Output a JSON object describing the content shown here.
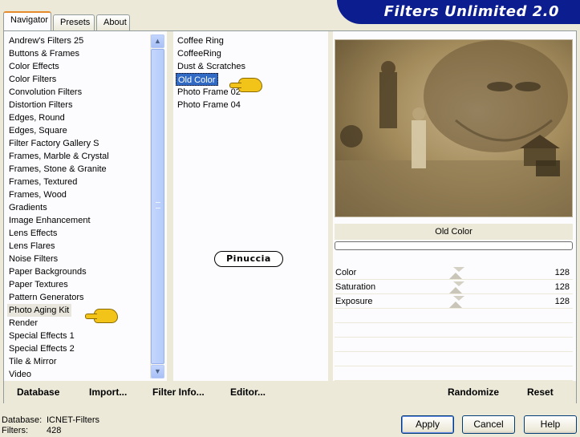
{
  "window": {
    "title": "Filters Unlimited 2.0"
  },
  "tabs": [
    {
      "label": "Navigator",
      "active": true
    },
    {
      "label": "Presets",
      "active": false
    },
    {
      "label": "About",
      "active": false
    }
  ],
  "categories": [
    "Andrew's Filters 25",
    "Buttons & Frames",
    "Color Effects",
    "Color Filters",
    "Convolution Filters",
    "Distortion Filters",
    "Edges, Round",
    "Edges, Square",
    "Filter Factory Gallery S",
    "Frames, Marble & Crystal",
    "Frames, Stone & Granite",
    "Frames, Textured",
    "Frames, Wood",
    "Gradients",
    "Image Enhancement",
    "Lens Effects",
    "Lens Flares",
    "Noise Filters",
    "Paper Backgrounds",
    "Paper Textures",
    "Pattern Generators",
    "Photo Aging Kit",
    "Render",
    "Special Effects 1",
    "Special Effects 2",
    "Tile & Mirror",
    "Video"
  ],
  "selected_category": "Photo Aging Kit",
  "filters": [
    "Coffee Ring",
    "CoffeeRing",
    "Dust & Scratches",
    "Old Color",
    "Photo Frame 02",
    "Photo Frame 04"
  ],
  "selected_filter": "Old Color",
  "watermark": "Pinuccia",
  "effect_name": "Old Color",
  "sliders": [
    {
      "label": "Color",
      "value": "128"
    },
    {
      "label": "Saturation",
      "value": "128"
    },
    {
      "label": "Exposure",
      "value": "128"
    }
  ],
  "bottom_buttons": {
    "database": "Database",
    "import": "Import...",
    "filter_info": "Filter Info...",
    "editor": "Editor...",
    "randomize": "Randomize",
    "reset": "Reset"
  },
  "status": {
    "database_label": "Database:",
    "database_value": "ICNET-Filters",
    "filters_label": "Filters:",
    "filters_value": "428"
  },
  "dialog_buttons": {
    "apply": "Apply",
    "cancel": "Cancel",
    "help": "Help"
  },
  "colors": {
    "title_banner": "#0c1d8f",
    "selection": "#316ac5",
    "dialog_bg": "#ece9d8",
    "tab_accent": "#e68b2c",
    "pointer": "#f2c318"
  },
  "icons": [
    "scroll-up-arrow-icon",
    "scroll-down-arrow-icon",
    "pointing-hand-icon"
  ]
}
